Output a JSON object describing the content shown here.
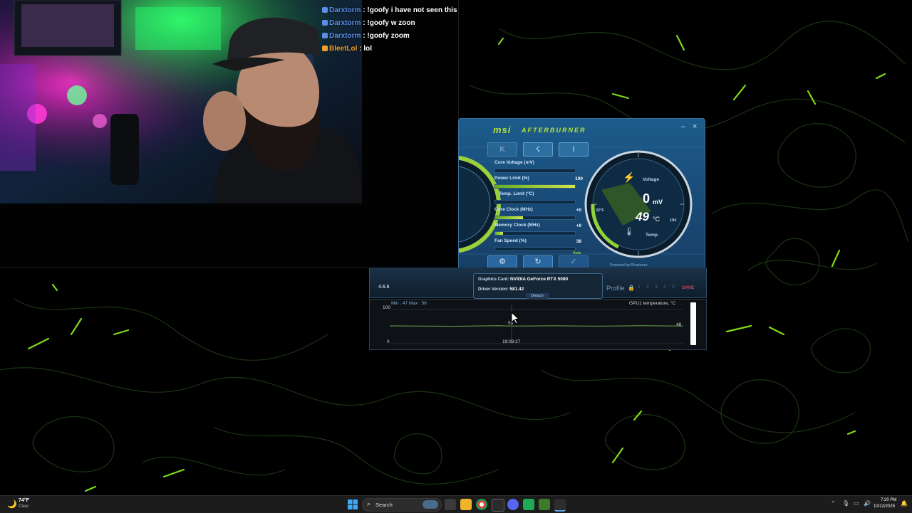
{
  "chat": {
    "messages": [
      {
        "user": "Darxtorm",
        "message": "!goofy i have not seen this",
        "color": "#5b8ee8"
      },
      {
        "user": "Darxtorm",
        "message": "!goofy w zoon",
        "color": "#5b8ee8"
      },
      {
        "user": "Darxtorm",
        "message": "!goofy zoom",
        "color": "#5b8ee8"
      },
      {
        "user": "BleetLol",
        "message": "lol",
        "color": "#f0a030"
      }
    ],
    "separator": ":"
  },
  "afterburner": {
    "brand": "msi",
    "product": "AFTERBURNER",
    "window_minimize": "–",
    "window_close": "×",
    "top_buttons": {
      "k_label": "K",
      "oc_label": "☇",
      "info_label": "i"
    },
    "sliders": {
      "core_voltage": {
        "label": "Core Voltage (mV)",
        "value": "",
        "fill": 0.0
      },
      "power_limit": {
        "label": "Power Limit (%)",
        "value": "100",
        "fill": 1.0
      },
      "temp_limit": {
        "label": "Temp. Limit (°C)",
        "value": "",
        "fill": 0.0
      },
      "core_clock": {
        "label": "Core Clock (MHz)",
        "value": "+0",
        "fill": 0.35
      },
      "memory_clock": {
        "label": "Memory Clock (MHz)",
        "value": "+0",
        "fill": 0.1
      },
      "fan_speed": {
        "label": "Fan Speed (%)",
        "value": "38",
        "fill": 0.0
      }
    },
    "fan_auto": "Auto",
    "gauge": {
      "voltage_label": "Voltage",
      "voltage_value": "0",
      "voltage_unit": "mV",
      "temp_value": "49",
      "temp_unit": "°C",
      "temp_label": "Temp.",
      "temp_f": "32°F",
      "temp_mark": "194",
      "powered_by": "Powered by Rivatuner"
    },
    "bottom_buttons": {
      "settings": "⚙",
      "reset": "↻",
      "apply": "✓"
    },
    "version": "4.6.6",
    "graphics_card_label": "Graphics Card:",
    "graphics_card": "NVIDIA GeForce RTX 5080",
    "driver_label": "Driver Version:",
    "driver_version": "581.42",
    "profile_label": "Profile",
    "profile_slots": [
      "1",
      "2",
      "3",
      "4",
      "5"
    ],
    "save_label": "SAVE",
    "detach_label": "Detach",
    "graph": {
      "min_max": "Min : 47   Max : 56",
      "title": "GPU1 temperature, °C",
      "y_top": "100",
      "y_bottom": "0",
      "current": "48",
      "cursor_value": "55",
      "cursor_time": "19:08:27"
    }
  },
  "taskbar": {
    "weather_temp": "74°F",
    "weather_condition": "Clear",
    "search_label": "Search",
    "time": "7:20 PM",
    "date": "10/12/2025"
  }
}
